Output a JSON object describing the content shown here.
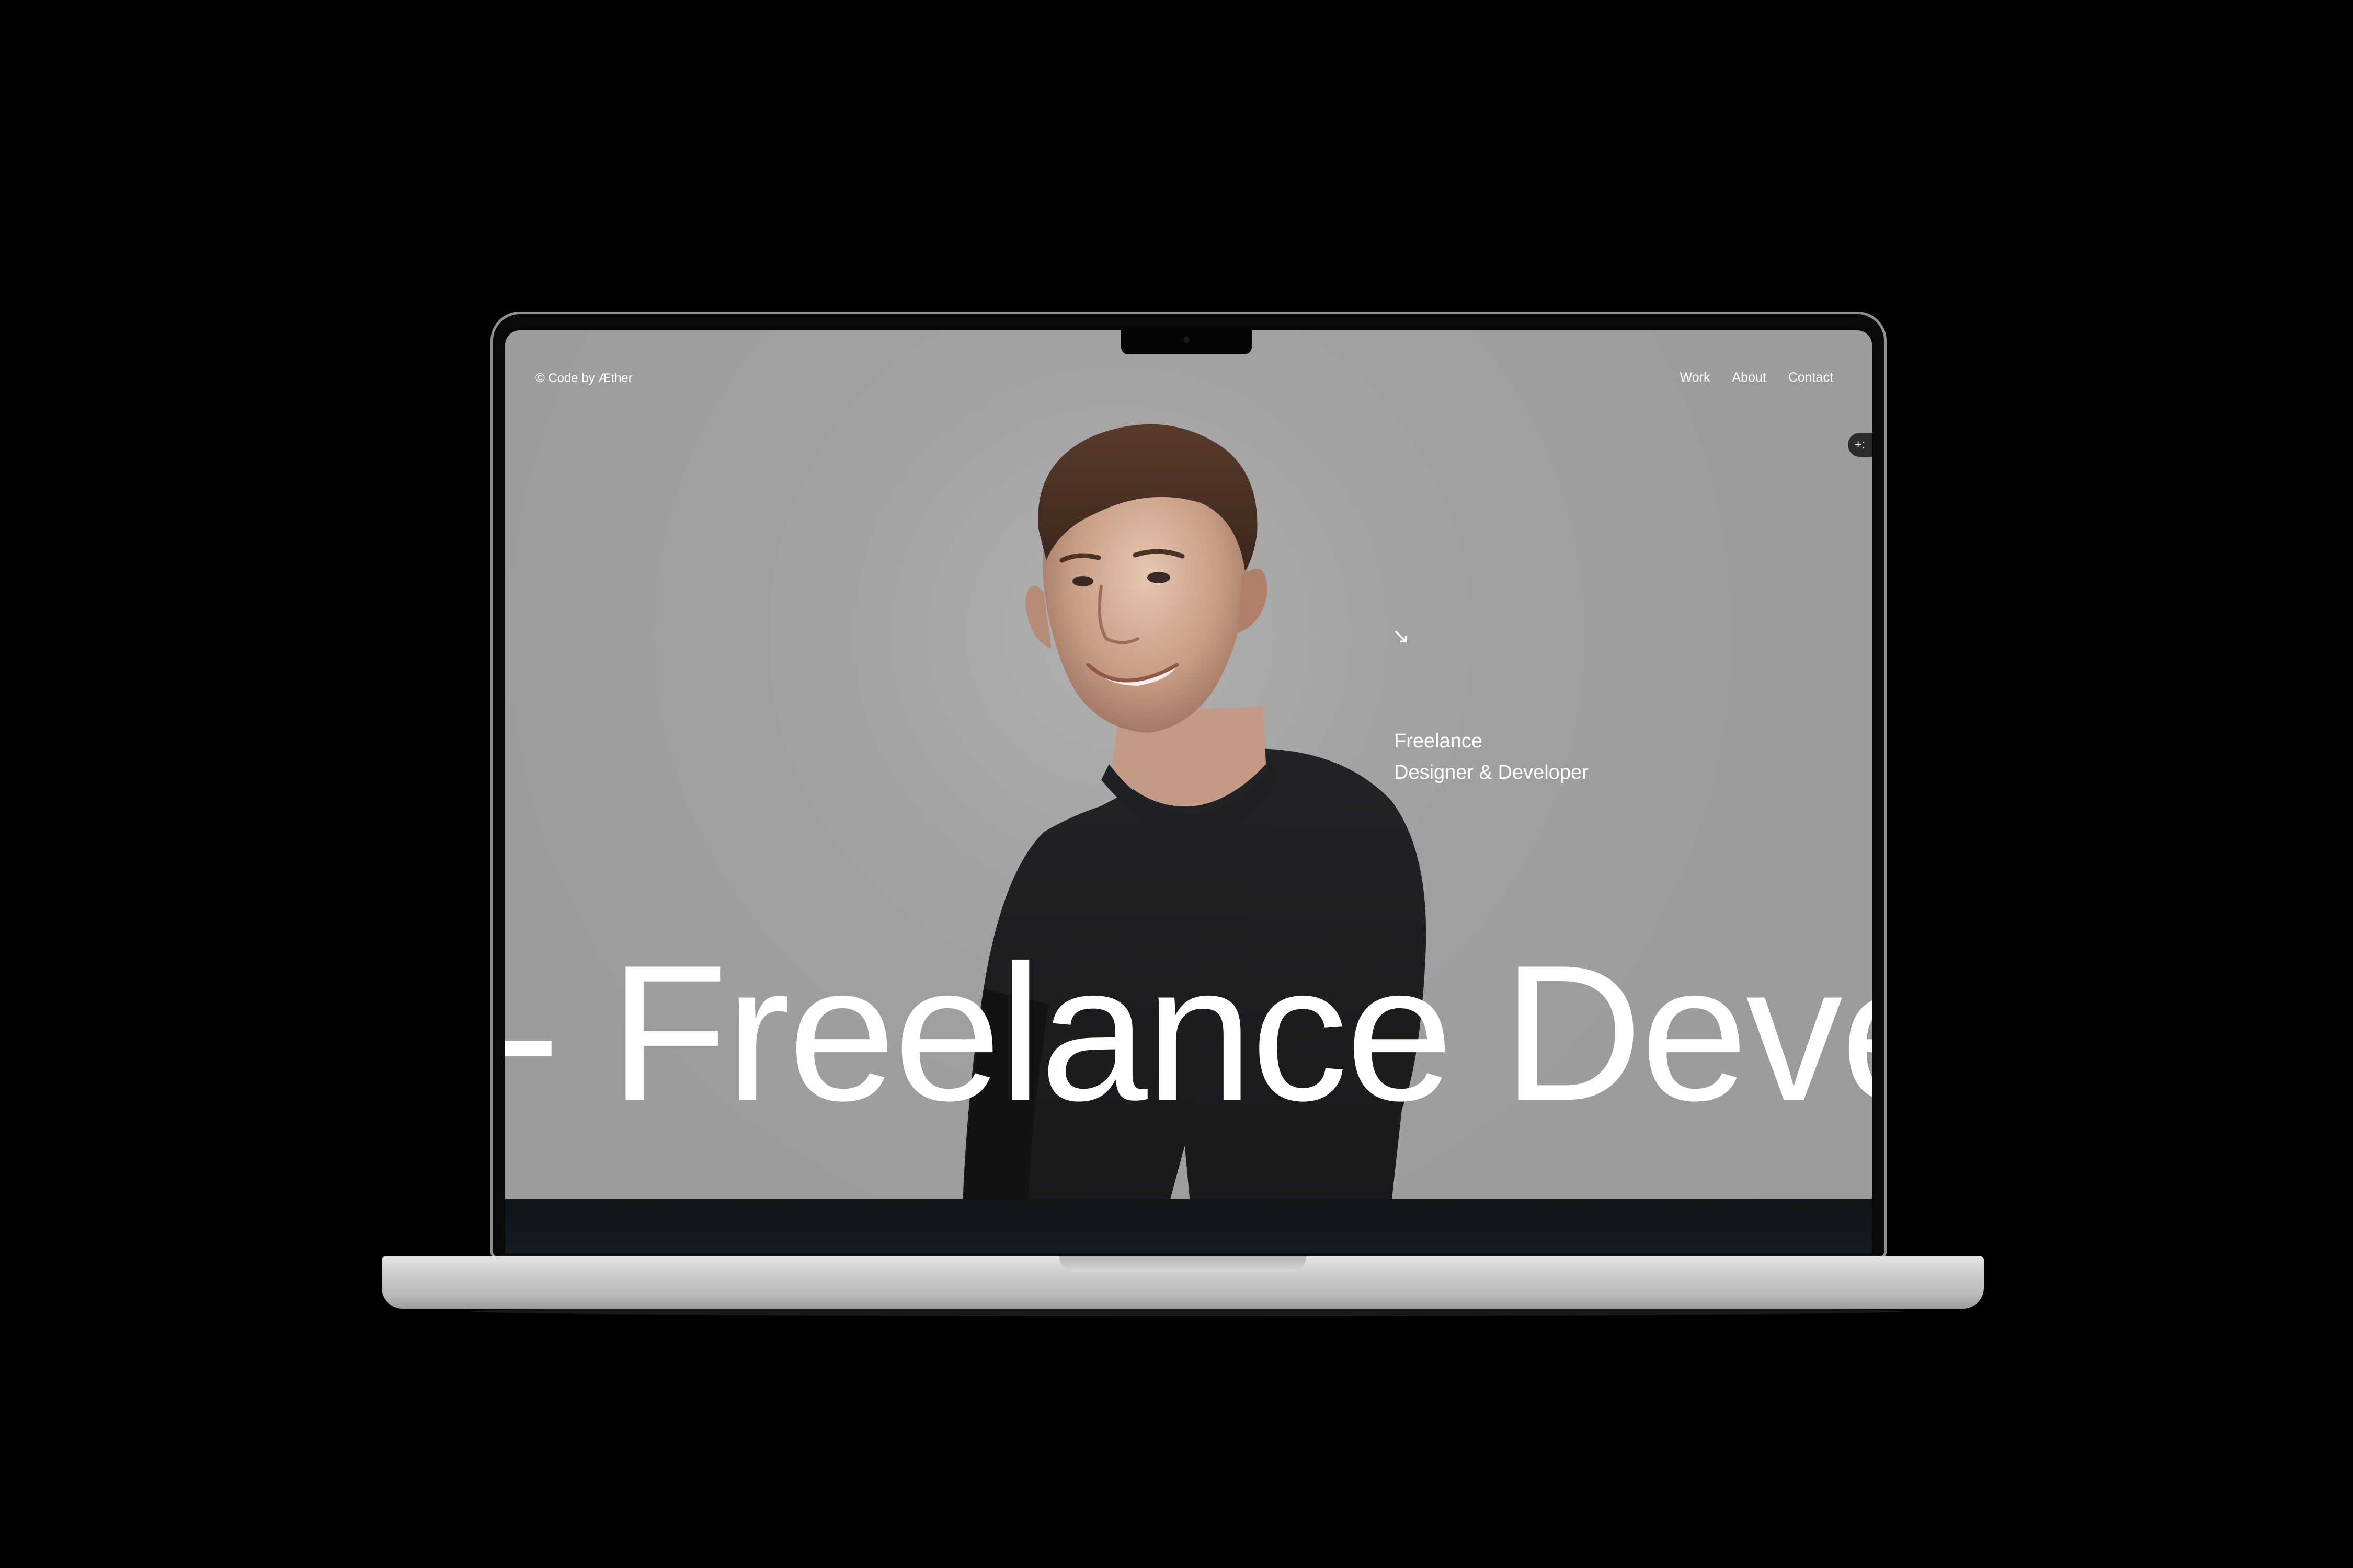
{
  "site": {
    "logo_text": "© Code by Æther",
    "nav": {
      "work": "Work",
      "about": "About",
      "contact": "Contact"
    },
    "hero": {
      "arrow_glyph": "↘",
      "role_line1": "Freelance",
      "role_line2": "Designer & Developer",
      "marquee_text": "- Freelance Deve"
    },
    "side_chip_glyph": "+:"
  },
  "colors": {
    "page_background": "#000000",
    "screen_background": "#9c9d9e",
    "text": "#ffffff",
    "sweater": "#1b1c1e"
  },
  "icons": {
    "arrow": "arrow-down-right-icon",
    "side_chip": "sparkle-chip-icon"
  }
}
